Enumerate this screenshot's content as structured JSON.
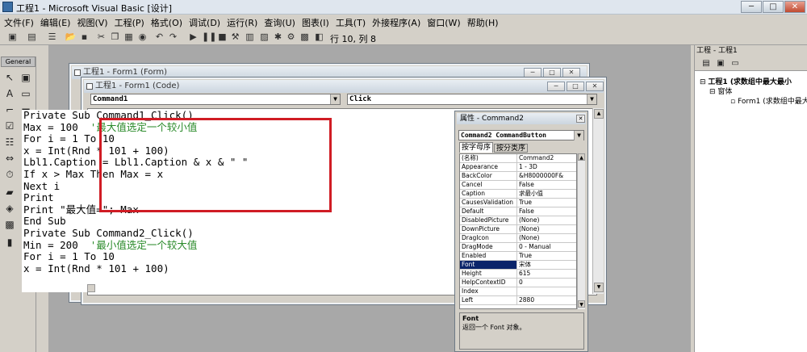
{
  "app": {
    "title": "工程1 - Microsoft Visual Basic [设计]"
  },
  "window_controls": {
    "minimize": "─",
    "maximize": "□",
    "close": "✕"
  },
  "menu": [
    "文件(F)",
    "编辑(E)",
    "视图(V)",
    "工程(P)",
    "格式(O)",
    "调试(D)",
    "运行(R)",
    "查询(U)",
    "图表(I)",
    "工具(T)",
    "外接程序(A)",
    "窗口(W)",
    "帮助(H)"
  ],
  "toolbar": {
    "position_text": "行 10, 列 8"
  },
  "toolbox": {
    "title": "General"
  },
  "form_window": {
    "title": "工程1 - Form1 (Form)"
  },
  "code_window": {
    "title": "工程1 - Form1 (Code)",
    "object_combo": "Command1",
    "proc_combo": "Click",
    "lines": [
      {
        "code": "Private Sub Command1_Click()",
        "comment": ""
      },
      {
        "code": "Max = 100  ",
        "comment": "'最大值选定一个较小值"
      },
      {
        "code": "For i = 1 To 10",
        "comment": ""
      },
      {
        "code": "x = Int(Rnd * 101 + 100)",
        "comment": ""
      },
      {
        "code": "Lbl1.Caption = Lbl1.Caption & x & \" \"",
        "comment": ""
      },
      {
        "code": "If x > Max Then Max = x",
        "comment": ""
      },
      {
        "code": "Next i",
        "comment": ""
      },
      {
        "code": "Print",
        "comment": ""
      },
      {
        "code": "Print \"最大值=\"; Max",
        "comment": ""
      },
      {
        "code": "End Sub",
        "comment": ""
      },
      {
        "code": "",
        "comment": ""
      },
      {
        "code": "Private Sub Command2_Click()",
        "comment": ""
      },
      {
        "code": "Min = 200  ",
        "comment": "'最小值选定一个较大值"
      },
      {
        "code": "For i = 1 To 10",
        "comment": ""
      },
      {
        "code": "x = Int(Rnd * 101 + 100)",
        "comment": ""
      }
    ]
  },
  "properties": {
    "title": "属性 - Command2",
    "object_combo": "Command2 CommandButton",
    "tabs": [
      "按字母序",
      "按分类序"
    ],
    "rows": [
      {
        "name": "(名称)",
        "value": "Command2"
      },
      {
        "name": "Appearance",
        "value": "1 - 3D"
      },
      {
        "name": "BackColor",
        "value": "&H8000000F&"
      },
      {
        "name": "Cancel",
        "value": "False"
      },
      {
        "name": "Caption",
        "value": "求最小值"
      },
      {
        "name": "CausesValidation",
        "value": "True"
      },
      {
        "name": "Default",
        "value": "False"
      },
      {
        "name": "DisabledPicture",
        "value": "(None)"
      },
      {
        "name": "DownPicture",
        "value": "(None)"
      },
      {
        "name": "DragIcon",
        "value": "(None)"
      },
      {
        "name": "DragMode",
        "value": "0 - Manual"
      },
      {
        "name": "Enabled",
        "value": "True"
      },
      {
        "name": "Font",
        "value": "宋体"
      },
      {
        "name": "Height",
        "value": "615"
      },
      {
        "name": "HelpContextID",
        "value": "0"
      },
      {
        "name": "Index",
        "value": ""
      },
      {
        "name": "Left",
        "value": "2880"
      }
    ],
    "selected_row": "Font",
    "desc_title": "Font",
    "desc_text": "返回一个 Font 对象。"
  },
  "project": {
    "title": "工程 - 工程1",
    "root": "工程1 (求数组中最大最小",
    "folder": "窗体",
    "form": "Form1 (求数组中最大"
  },
  "colors": {
    "highlight_box": "#d01c24",
    "comment": "#2a8a2a",
    "selected": "#0a246a"
  }
}
